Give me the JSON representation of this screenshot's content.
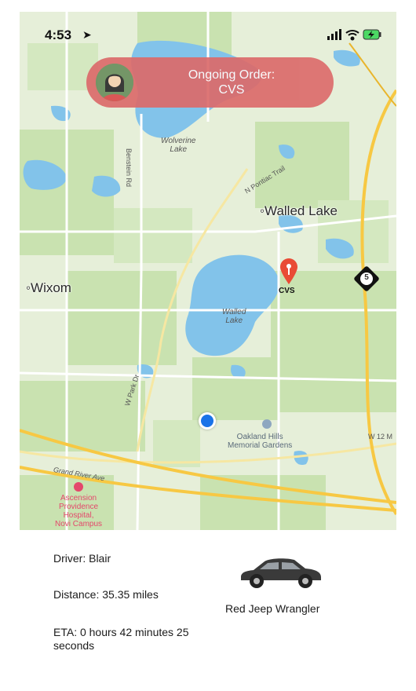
{
  "status_bar": {
    "time": "4:53",
    "location_arrow": "location-arrow-icon",
    "icons": [
      "signal-icon",
      "wifi-icon",
      "battery-charging-icon"
    ]
  },
  "banner": {
    "line1": "Ongoing Order:",
    "line2": "CVS",
    "avatar": "avatar-icon",
    "color": "#dc6b6b"
  },
  "map": {
    "places": {
      "walled_lake_city": "Walled Lake",
      "wixom": "Wixom",
      "walled_lake_water": "Walled\nLake",
      "wolverine_lake": "Wolverine\nLake",
      "bendain_rd": "Benstein Rd",
      "pontiac_trail": "N Pontiac Trail",
      "w_park_dr": "W Park Dr",
      "grand_river": "Grand River Ave",
      "oakland_hills": "Oakland Hills\nMemorial Gardens",
      "hospital": "Ascension\nProvidence\nHospital,\nNovi Campus",
      "w12": "W 12 M",
      "highway_shield": "5"
    },
    "pin": {
      "label": "CVS",
      "color": "#e94b35"
    },
    "user_location_color": "#1a73e8"
  },
  "driver": {
    "name_line": "Driver: Blair",
    "distance_line": "Distance: 35.35 miles",
    "eta_line": "ETA: 0 hours 42 minutes 25 seconds",
    "vehicle": "Red Jeep Wrangler",
    "vehicle_icon": "car-icon"
  }
}
